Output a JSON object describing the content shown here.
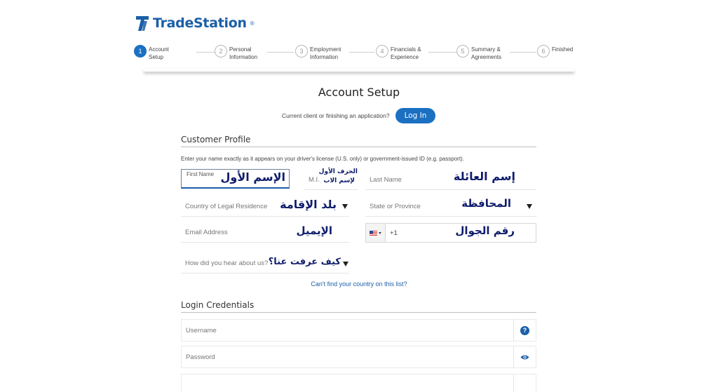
{
  "brand": {
    "name": "TradeStation",
    "reg": "®",
    "color": "#1b5fa8"
  },
  "steps": [
    {
      "num": "1",
      "label": "Account\nSetup",
      "active": true
    },
    {
      "num": "2",
      "label": "Personal\nInformation",
      "active": false
    },
    {
      "num": "3",
      "label": "Employment\nInformation",
      "active": false
    },
    {
      "num": "4",
      "label": "Financials &\nExperience",
      "active": false
    },
    {
      "num": "5",
      "label": "Summary &\nAgreements",
      "active": false
    },
    {
      "num": "6",
      "label": "Finished",
      "active": false
    }
  ],
  "page": {
    "title": "Account Setup",
    "login_prompt": "Current client or finishing an application?",
    "login_button": "Log In"
  },
  "customer_profile": {
    "title": "Customer Profile",
    "instructions": "Enter your name exactly as it appears on your driver's license (U.S. only) or government-issued ID (e.g. passport).",
    "first_name_label": "First Name",
    "first_name_arabic": "الإسم الأول",
    "mi_placeholder": "M.I.",
    "mi_arabic_line1": "الحرف الأول",
    "mi_arabic_line2": "لإسم الاب",
    "last_name_placeholder": "Last Name",
    "last_name_arabic": "إسم العائلة",
    "country_placeholder": "Country of Legal Residence",
    "country_arabic": "بلد الإقامة",
    "state_placeholder": "State or Province",
    "state_arabic": "المحافظة",
    "email_placeholder": "Email Address",
    "email_arabic": "الإيميل",
    "phone_code": "+1",
    "phone_arabic": "رقم الجوال",
    "hear_placeholder": "How did you hear about us?",
    "hear_arabic": "كيف عرفت عنا؟",
    "country_link": "Can't find your country on this list?"
  },
  "login_credentials": {
    "title": "Login Credentials",
    "username_placeholder": "Username",
    "password_placeholder": "Password",
    "help_icon_glyph": "?"
  },
  "colors": {
    "accent": "#1b70c2",
    "arabic_annotation": "#0f1c6b"
  }
}
